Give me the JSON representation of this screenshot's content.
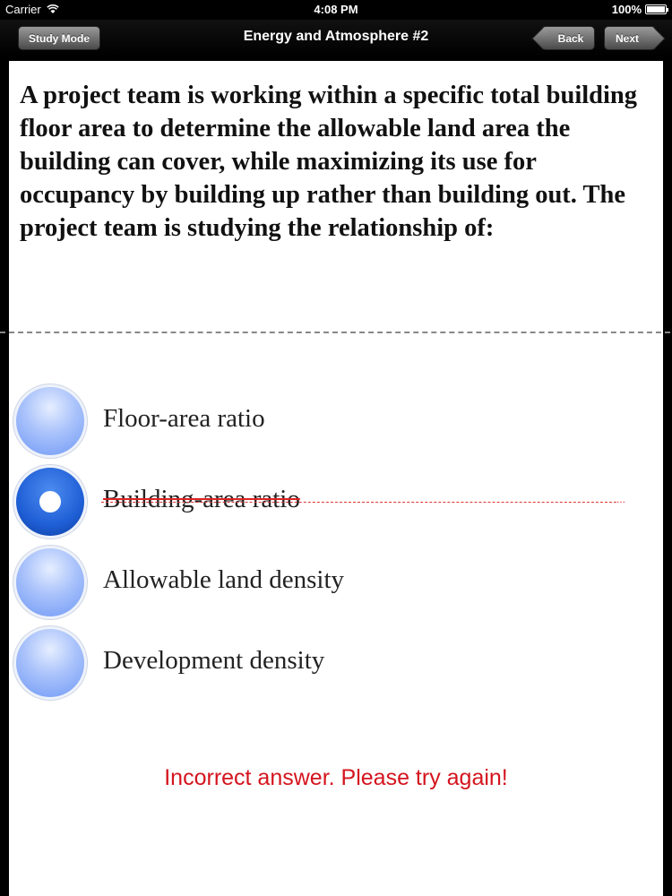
{
  "status_bar": {
    "carrier": "Carrier",
    "wifi_icon": "wifi-icon",
    "time": "4:08 PM",
    "battery": "100%"
  },
  "nav": {
    "title": "Energy and Atmosphere #2",
    "study_mode_label": "Study Mode",
    "back_label": "Back",
    "next_label": "Next"
  },
  "question": {
    "text": "A project team is working within a specific total building floor area to determine the allowable land area the building can cover, while maximizing its use for occupancy by building up rather than building out. The project team is studying the relationship of:"
  },
  "options": [
    {
      "label": "Floor-area ratio",
      "selected": false,
      "struck": false
    },
    {
      "label": "Building-area ratio",
      "selected": true,
      "struck": true
    },
    {
      "label": "Allowable land density",
      "selected": false,
      "struck": false
    },
    {
      "label": "Development density",
      "selected": false,
      "struck": false
    }
  ],
  "feedback": {
    "text": "Incorrect answer. Please try again!",
    "color": "#d4141e"
  },
  "colors": {
    "nav_background": "#000000",
    "radio_unselected": "#8fb0f7",
    "radio_selected": "#1f5fd6"
  }
}
